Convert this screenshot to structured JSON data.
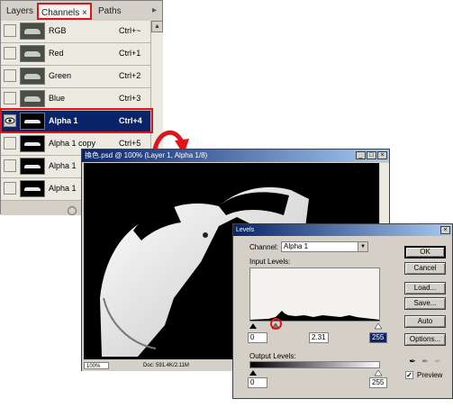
{
  "panel": {
    "tabs": {
      "layers": "Layers",
      "channels": "Channels",
      "paths": "Paths",
      "close_glyph": "×"
    },
    "menu_glyph": "▸",
    "channels": [
      {
        "name": "RGB",
        "shortcut": "Ctrl+~"
      },
      {
        "name": "Red",
        "shortcut": "Ctrl+1"
      },
      {
        "name": "Green",
        "shortcut": "Ctrl+2"
      },
      {
        "name": "Blue",
        "shortcut": "Ctrl+3"
      },
      {
        "name": "Alpha 1",
        "shortcut": "Ctrl+4",
        "selected": true
      },
      {
        "name": "Alpha 1 copy",
        "shortcut": "Ctrl+5"
      },
      {
        "name": "Alpha 1",
        "shortcut": ""
      },
      {
        "name": "Alpha 1",
        "shortcut": ""
      }
    ]
  },
  "document": {
    "title": "換色.psd @ 100% (Layer 1, Alpha 1/8)",
    "zoom": "100%",
    "doc_info": "Doc: 591.4K/2.11M"
  },
  "levels": {
    "title": "Levels",
    "channel_label": "Channel:",
    "channel_value": "Alpha 1",
    "input_levels_label": "Input Levels:",
    "input_black": "0",
    "input_gamma": "2.31",
    "input_white": "255",
    "output_levels_label": "Output Levels:",
    "output_black": "0",
    "output_white": "255",
    "buttons": {
      "ok": "OK",
      "cancel": "Cancel",
      "load": "Load...",
      "save": "Save...",
      "auto": "Auto",
      "options": "Options..."
    },
    "preview_label": "Preview",
    "preview_checked": true
  },
  "colors": {
    "highlight": "#e0141a",
    "selection": "#0a246a",
    "titlebar": "#0a246a"
  }
}
